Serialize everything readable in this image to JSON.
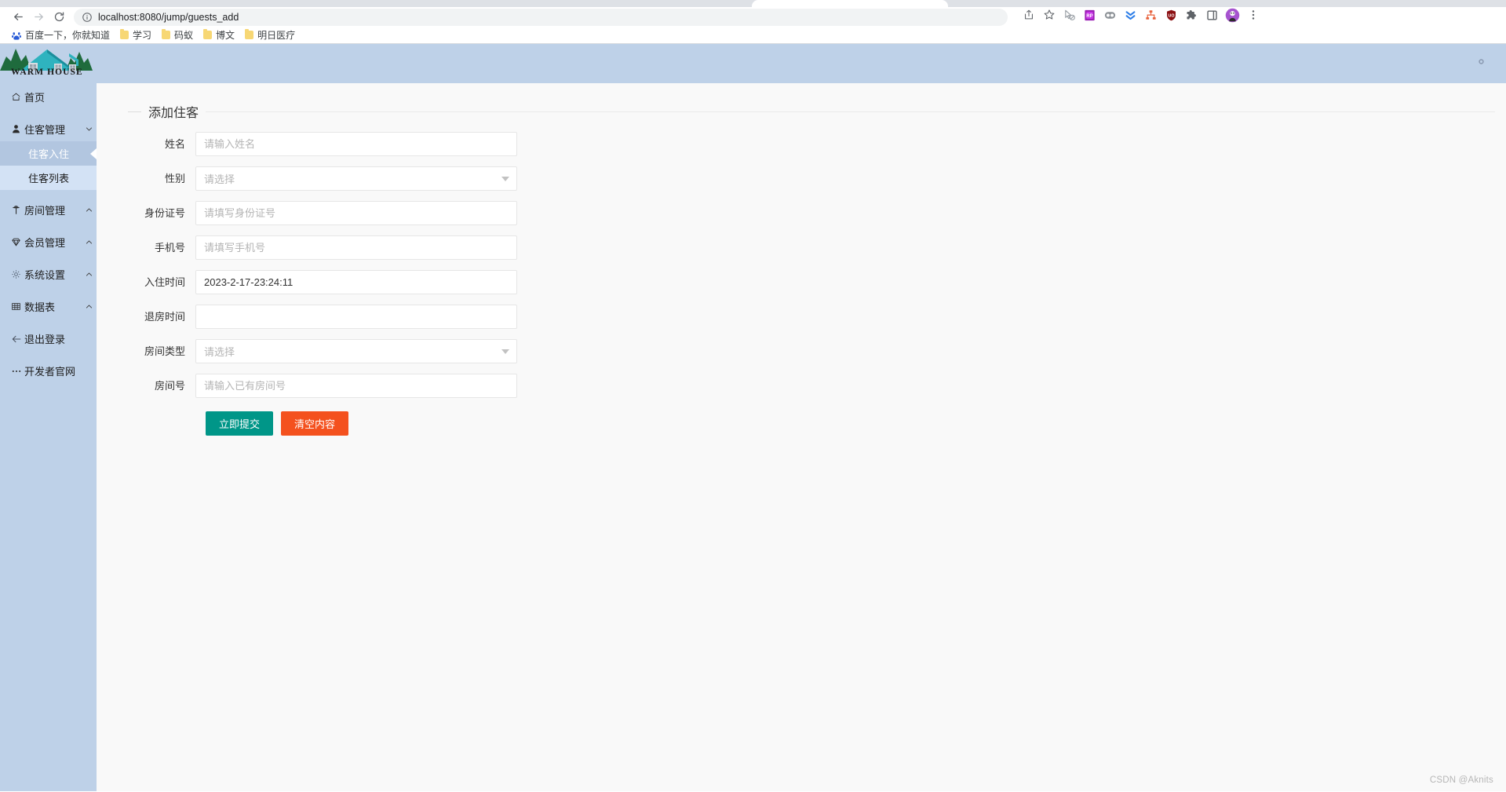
{
  "browser": {
    "nav": {
      "back_icon": "arrow-left-icon",
      "forward_icon": "arrow-right-icon",
      "reload_icon": "reload-icon"
    },
    "omnibox": {
      "info_icon": "site-info-icon",
      "url": "localhost:8080/jump/guests_add",
      "share_icon": "share-icon",
      "bookmark_icon": "star-icon"
    },
    "extensions": [
      {
        "name": "cursor-block-icon",
        "glyph": "➤"
      },
      {
        "name": "rp-extension-icon",
        "glyph": "RP"
      },
      {
        "name": "dual-circle-extension-icon",
        "glyph": "●●"
      },
      {
        "name": "double-chevron-down-icon",
        "glyph": "»"
      },
      {
        "name": "sitemap-extension-icon",
        "glyph": "⑂"
      },
      {
        "name": "ublock-origin-icon",
        "glyph": "UO"
      },
      {
        "name": "puzzle-extensions-icon",
        "glyph": "❖"
      },
      {
        "name": "side-panel-icon",
        "glyph": "□"
      }
    ],
    "profile_icon": "profile-avatar-icon",
    "menu_icon": "three-dot-menu-icon",
    "bookmarks": [
      {
        "label": "百度一下，你就知道",
        "icon": "baidu-icon"
      },
      {
        "label": "学习",
        "icon": "folder-icon"
      },
      {
        "label": "码蚁",
        "icon": "folder-icon"
      },
      {
        "label": "博文",
        "icon": "folder-icon"
      },
      {
        "label": "明日医疗",
        "icon": "folder-icon"
      }
    ]
  },
  "colors": {
    "sidebar": "#bed1e8",
    "topbar": "#bed1e8",
    "submit": "#009688",
    "reset": "#f4511e",
    "content_bg": "#f9f9f9"
  },
  "sidebar": {
    "logo_text_1": "W",
    "logo_text": "ARM ",
    "logo_text_2": "H",
    "logo_text_3": "OUSE",
    "logo_full": "WARM HOUSE",
    "items": [
      {
        "label": "首页",
        "icon": "home-icon",
        "arrow": "",
        "type": "link"
      },
      {
        "label": "住客管理",
        "icon": "user-icon",
        "arrow": "chevron-down-icon",
        "type": "group"
      },
      {
        "label": "住客入住",
        "icon": "",
        "arrow": "",
        "type": "sub",
        "state": "active"
      },
      {
        "label": "住客列表",
        "icon": "",
        "arrow": "",
        "type": "sub",
        "state": "hover"
      },
      {
        "label": "房间管理",
        "icon": "key-icon",
        "arrow": "chevron-up-icon",
        "type": "group"
      },
      {
        "label": "会员管理",
        "icon": "diamond-icon",
        "arrow": "chevron-up-icon",
        "type": "group"
      },
      {
        "label": "系统设置",
        "icon": "gear-icon",
        "arrow": "chevron-up-icon",
        "type": "group"
      },
      {
        "label": "数据表",
        "icon": "table-icon",
        "arrow": "chevron-up-icon",
        "type": "group"
      },
      {
        "label": "退出登录",
        "icon": "arrow-left-icon",
        "arrow": "",
        "type": "link"
      },
      {
        "label": "开发者官网",
        "icon": "ellipsis-icon",
        "arrow": "",
        "type": "link"
      }
    ]
  },
  "topbar": {
    "settings_icon": "gear-icon"
  },
  "form": {
    "title": "添加住客",
    "fields": [
      {
        "label": "姓名",
        "type": "text",
        "value": "",
        "placeholder": "请输入姓名",
        "name": "name-field"
      },
      {
        "label": "性别",
        "type": "select",
        "value": "",
        "placeholder": "请选择",
        "name": "gender-select"
      },
      {
        "label": "身份证号",
        "type": "text",
        "value": "",
        "placeholder": "请填写身份证号",
        "name": "id-card-field"
      },
      {
        "label": "手机号",
        "type": "text",
        "value": "",
        "placeholder": "请填写手机号",
        "name": "phone-field"
      },
      {
        "label": "入住时间",
        "type": "text",
        "value": "2023-2-17-23:24:11",
        "placeholder": "",
        "name": "checkin-time-field"
      },
      {
        "label": "退房时间",
        "type": "text",
        "value": "",
        "placeholder": "",
        "name": "checkout-time-field"
      },
      {
        "label": "房间类型",
        "type": "select",
        "value": "",
        "placeholder": "请选择",
        "name": "room-type-select"
      },
      {
        "label": "房间号",
        "type": "text",
        "value": "",
        "placeholder": "请输入已有房间号",
        "name": "room-number-field"
      }
    ],
    "submit_label": "立即提交",
    "reset_label": "清空内容"
  },
  "watermark": "CSDN @Aknits"
}
